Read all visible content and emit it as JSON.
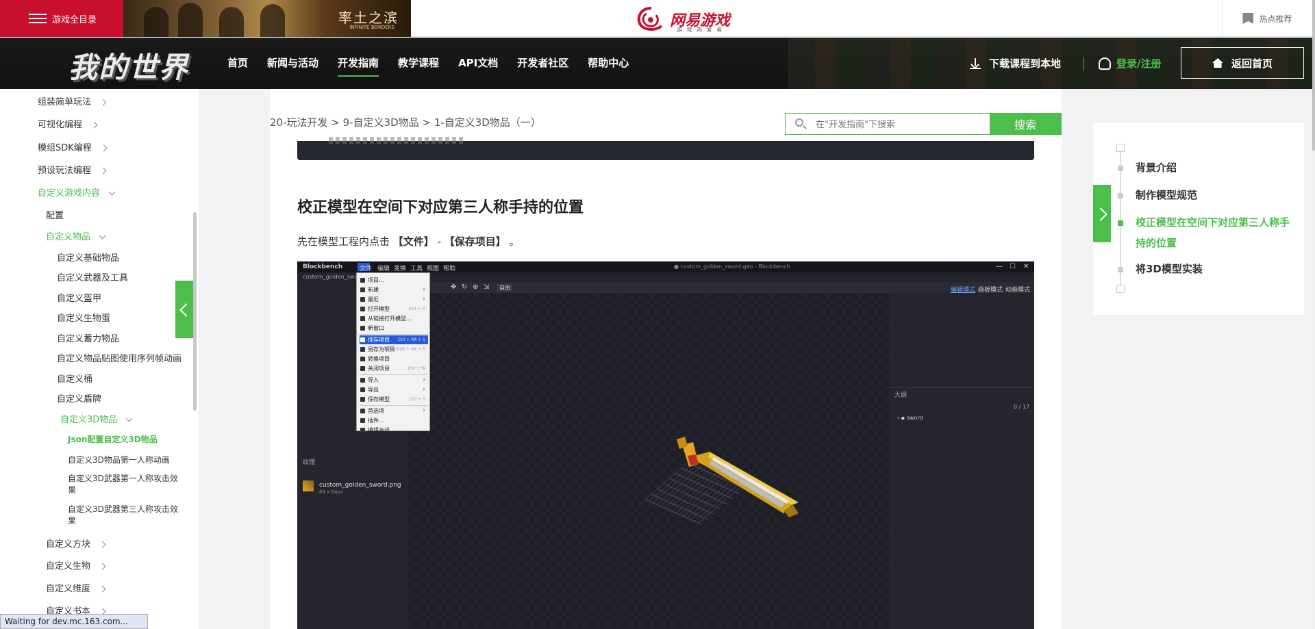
{
  "topbar": {
    "game_directory": "游戏全目录",
    "banner_title": "率土之滨",
    "banner_subtitle": "INFINITE BORDERS",
    "netease_logo": "网易游戏",
    "netease_slogan": "游 戏 热 爱 者",
    "hot_recommend": "热点推荐"
  },
  "nav": {
    "logo": "我的世界",
    "items": [
      "首页",
      "新闻与活动",
      "开发指南",
      "教学课程",
      "API文档",
      "开发者社区",
      "帮助中心"
    ],
    "active_index": 2,
    "download": "下载课程到本地",
    "login": "登录/注册",
    "home": "返回首页"
  },
  "sidebar": {
    "items": [
      "组装简单玩法",
      "可视化编程",
      "模组SDK编程",
      "预设玩法编程",
      "自定义游戏内容",
      "配置",
      "自定义物品",
      "自定义基础物品",
      "自定义武器及工具",
      "自定义盔甲",
      "自定义生物蛋",
      "自定义蓄力物品",
      "自定义物品贴图使用序列帧动画",
      "自定义桶",
      "自定义盾牌",
      "自定义3D物品",
      "Json配置自定义3D物品",
      "自定义3D物品第一人称动画",
      "自定义3D武器第一人称攻击效",
      "果",
      "自定义3D武器第三人称攻击效",
      "果",
      "自定义方块",
      "自定义生物",
      "自定义维度",
      "自定义书本"
    ],
    "status": "Waiting for dev.mc.163.com..."
  },
  "main": {
    "breadcrumb": "20-玩法开发 > 9-自定义3D物品 > 1-自定义3D物品（一）",
    "search_placeholder": "在\"开发指南\"下搜索",
    "search_button": "搜索",
    "heading": "校正模型在空间下对应第三人称手持的位置",
    "para_prefix": "先在模型工程内点击 ",
    "para_file": "【文件】",
    "para_mid": " - ",
    "para_save": "【保存项目】",
    "para_end": " 。"
  },
  "blockbench": {
    "app": "Blockbench",
    "menus": [
      "文件",
      "编辑",
      "变换",
      "工具",
      "视图",
      "帮助"
    ],
    "window_title": "● custom_golden_sword.geo - Blockbench",
    "tab": "custom_golden_swo",
    "modes": [
      "编辑模式",
      "画板模式",
      "动画模式"
    ],
    "file_menu": [
      {
        "label": "项目...",
        "shortcut": "",
        "sub": false
      },
      {
        "label": "新建",
        "shortcut": "",
        "sub": true
      },
      {
        "label": "最近",
        "shortcut": "",
        "sub": true
      },
      {
        "label": "打开模型",
        "shortcut": "Ctrl + O",
        "sub": false
      },
      {
        "label": "从链接打开模型...",
        "shortcut": "",
        "sub": false
      },
      {
        "label": "新窗口",
        "shortcut": "",
        "sub": false
      },
      {
        "label": "保存项目",
        "shortcut": "Ctrl + Alt + S",
        "sub": false,
        "highlight": true
      },
      {
        "label": "另存为项目",
        "shortcut": "Ctrl + Shift + Alt + S",
        "sub": false
      },
      {
        "label": "转换项目",
        "shortcut": "",
        "sub": false
      },
      {
        "label": "关闭项目",
        "shortcut": "Ctrl + W",
        "sub": false
      },
      {
        "label": "导入",
        "shortcut": "",
        "sub": true
      },
      {
        "label": "导出",
        "shortcut": "",
        "sub": true
      },
      {
        "label": "保存模型",
        "shortcut": "Ctrl + S",
        "sub": false
      },
      {
        "label": "首选项",
        "shortcut": "",
        "sub": true
      },
      {
        "label": "插件...",
        "shortcut": "",
        "sub": false
      },
      {
        "label": "编辑会话...",
        "shortcut": "",
        "sub": false
      }
    ],
    "textures_label": "纹理",
    "texture_name": "custom_golden_sword.png",
    "texture_size": "64 x 64px",
    "outliner_label": "大纲",
    "outliner_count": "0 / 17",
    "outliner_item": "sword",
    "view_dropdown": "自由"
  },
  "toc": {
    "items": [
      "背景介绍",
      "制作模型规范",
      "校正模型在空间下对应第三人称手持的位置",
      "将3D模型实装"
    ],
    "active_index": 2
  },
  "colors": {
    "accent": "#4cbe4c",
    "brand_red": "#c8102e",
    "nav_bg": "#111111"
  }
}
